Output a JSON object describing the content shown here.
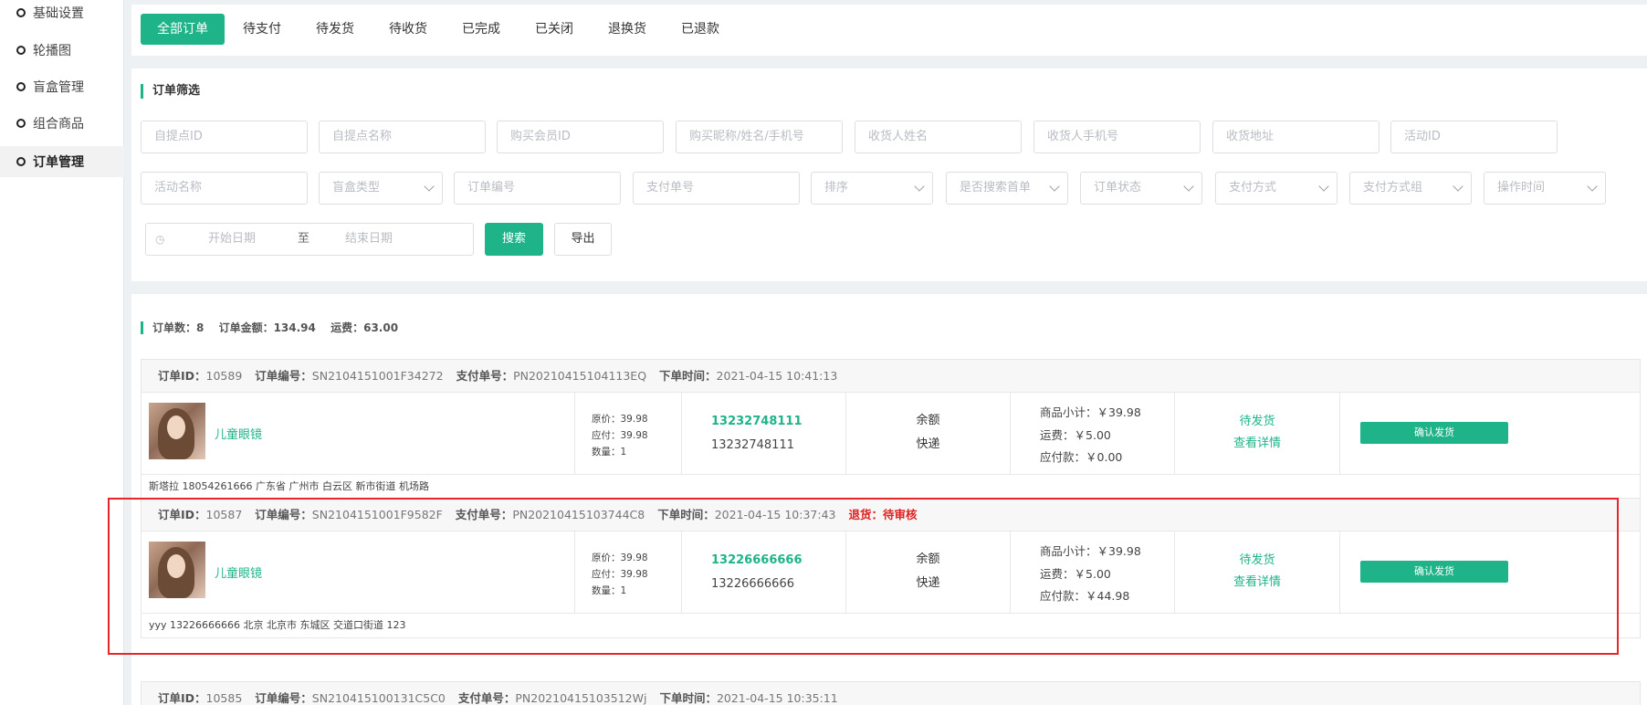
{
  "sidebar": {
    "items": [
      {
        "label": "基础设置"
      },
      {
        "label": "轮播图"
      },
      {
        "label": "盲盒管理"
      },
      {
        "label": "组合商品"
      },
      {
        "label": "订单管理"
      }
    ]
  },
  "tabs": [
    {
      "label": "全部订单"
    },
    {
      "label": "待支付"
    },
    {
      "label": "待发货"
    },
    {
      "label": "待收货"
    },
    {
      "label": "已完成"
    },
    {
      "label": "已关闭"
    },
    {
      "label": "退换货"
    },
    {
      "label": "已退款"
    }
  ],
  "filter": {
    "title": "订单筛选",
    "row1": [
      "自提点ID",
      "自提点名称",
      "购买会员ID",
      "购买昵称/姓名/手机号",
      "收货人姓名",
      "收货人手机号",
      "收货地址",
      "活动ID"
    ],
    "row2_name": "活动名称",
    "box_type": "盲盒类型",
    "order_no": "订单编号",
    "pay_no": "支付单号",
    "selects": [
      "排序",
      "是否搜索首单",
      "订单状态",
      "支付方式",
      "支付方式组",
      "操作时间"
    ],
    "date_start": "开始日期",
    "date_sep": "至",
    "date_end": "结束日期",
    "search_label": "搜索",
    "export_label": "导出"
  },
  "stats": {
    "count_label": "订单数：",
    "count": "8",
    "amount_label": "订单金额：",
    "amount": "134.94",
    "freight_label": "运费：",
    "freight": "63.00"
  },
  "labels": {
    "order_id": "订单ID：",
    "order_no": "订单编号：",
    "pay_no": "支付单号：",
    "time": "下单时间：",
    "orig": "原价：",
    "due": "应付：",
    "qty": "数量：",
    "subtotal": "商品小计：",
    "freight": "运费：",
    "payable": "应付款：",
    "detail": "查看详情",
    "ship": "确认发货"
  },
  "orders": [
    {
      "id": "10589",
      "no": "SN2104151001F34272",
      "pay_no": "PN20210415104113EQ",
      "time": "2021-04-15 10:41:13",
      "refund": "",
      "product": "儿童眼镜",
      "orig": "39.98",
      "due": "39.98",
      "qty": "1",
      "phone1": "13232748111",
      "phone2": "13232748111",
      "pay1": "余额",
      "pay2": "快递",
      "subtotal": "￥39.98",
      "freight": "￥5.00",
      "payable": "￥0.00",
      "status": "待发货",
      "address": "斯塔拉   18054261666   广东省 广州市 白云区 新市街道 机场路"
    },
    {
      "id": "10587",
      "no": "SN2104151001F9582F",
      "pay_no": "PN20210415103744C8",
      "time": "2021-04-15 10:37:43",
      "refund": "退货：待审核",
      "product": "儿童眼镜",
      "orig": "39.98",
      "due": "39.98",
      "qty": "1",
      "phone1": "13226666666",
      "phone2": "13226666666",
      "pay1": "余额",
      "pay2": "快递",
      "subtotal": "￥39.98",
      "freight": "￥5.00",
      "payable": "￥44.98",
      "status": "待发货",
      "address": "yyy   13226666666   北京 北京市 东城区 交道口街道 123"
    },
    {
      "id": "10585",
      "no": "SN210415100131C5C0",
      "pay_no": "PN20210415103512Wj",
      "time": "2021-04-15 10:35:11"
    }
  ]
}
